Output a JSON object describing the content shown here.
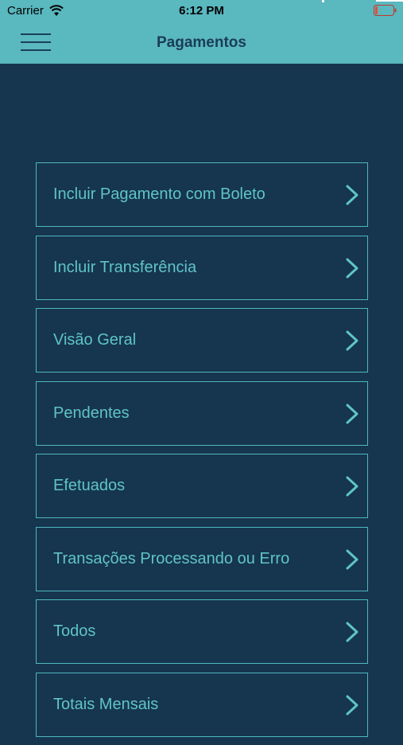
{
  "status_bar": {
    "carrier": "Carrier",
    "time": "6:12 PM",
    "icons": [
      "wifi-icon",
      "battery-icon"
    ]
  },
  "header": {
    "title": "Pagamentos",
    "menu_icon": "hamburger-menu-icon",
    "background": "#5ab8bf",
    "title_color": "#1a3c57"
  },
  "menu": {
    "items": [
      {
        "label": "Incluir Pagamento com Boleto",
        "icon": "chevron-right-icon"
      },
      {
        "label": "Incluir Transferência",
        "icon": "chevron-right-icon"
      },
      {
        "label": "Visão Geral",
        "icon": "chevron-right-icon"
      },
      {
        "label": "Pendentes",
        "icon": "chevron-right-icon"
      },
      {
        "label": "Efetuados",
        "icon": "chevron-right-icon"
      },
      {
        "label": "Transações Processando ou Erro",
        "icon": "chevron-right-icon"
      },
      {
        "label": "Todos",
        "icon": "chevron-right-icon"
      },
      {
        "label": "Totais Mensais",
        "icon": "chevron-right-icon"
      }
    ]
  },
  "colors": {
    "background": "#16354f",
    "accent": "#5fc4c9",
    "border": "#4fb7be"
  }
}
